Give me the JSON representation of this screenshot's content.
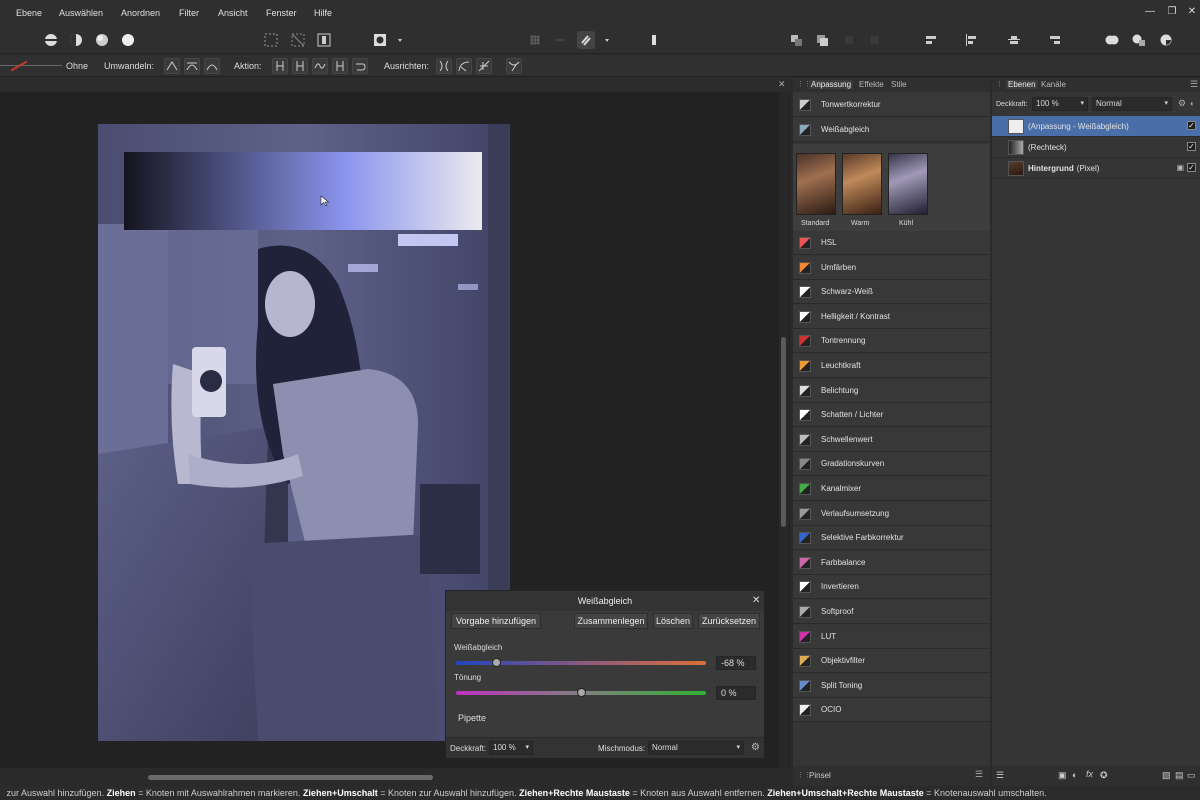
{
  "menu": [
    "Ebene",
    "Auswählen",
    "Anordnen",
    "Filter",
    "Ansicht",
    "Fenster",
    "Hilfe"
  ],
  "context_bar": {
    "stroke_value": "Ohne",
    "convert_label": "Umwandeln:",
    "action_label": "Aktion:",
    "align_label": "Ausrichten:"
  },
  "canvas": {
    "text_box_gradient": [
      "#14141e",
      "#8b95ee",
      "#eceaee"
    ]
  },
  "dialog": {
    "title": "Weißabgleich",
    "buttons": [
      "Vorgabe hinzufügen",
      "Zusammenlegen",
      "Löschen",
      "Zurücksetzen"
    ],
    "white_balance_label": "Weißabgleich",
    "white_balance_value": "-68 %",
    "white_balance_level": -0.68,
    "tint_label": "Tönung",
    "tint_value": "0 %",
    "tint_level": 0,
    "pipette_label": "Pipette",
    "opacity_label": "Deckkraft:",
    "opacity_value": "100 %",
    "blend_label": "Mischmodus:",
    "blend_value": "Normal"
  },
  "adjustments_panel": {
    "tabs": [
      "Anpassung",
      "Effekte",
      "Stile"
    ],
    "items_top": [
      {
        "label": "Tonwertkorrektur",
        "icon": "levels-icon"
      },
      {
        "label": "Weißabgleich",
        "icon": "white-balance-icon"
      }
    ],
    "presets": [
      "Standard",
      "Warm",
      "Kühl"
    ],
    "items": [
      {
        "label": "HSL",
        "icon": "hsl-icon"
      },
      {
        "label": "Umfärben",
        "icon": "recolor-icon"
      },
      {
        "label": "Schwarz-Weiß",
        "icon": "black-white-icon"
      },
      {
        "label": "Helligkeit / Kontrast",
        "icon": "brightness-contrast-icon"
      },
      {
        "label": "Tontrennung",
        "icon": "posterize-icon"
      },
      {
        "label": "Leuchtkraft",
        "icon": "vibrance-icon"
      },
      {
        "label": "Belichtung",
        "icon": "exposure-icon"
      },
      {
        "label": "Schatten / Lichter",
        "icon": "shadows-highlights-icon"
      },
      {
        "label": "Schwellenwert",
        "icon": "threshold-icon"
      },
      {
        "label": "Gradationskurven",
        "icon": "curves-icon"
      },
      {
        "label": "Kanalmixer",
        "icon": "channel-mixer-icon"
      },
      {
        "label": "Verlaufsumsetzung",
        "icon": "gradient-map-icon"
      },
      {
        "label": "Selektive Farbkorrektur",
        "icon": "selective-color-icon"
      },
      {
        "label": "Farbbalance",
        "icon": "color-balance-icon"
      },
      {
        "label": "Invertieren",
        "icon": "invert-icon"
      },
      {
        "label": "Softproof",
        "icon": "soft-proof-icon"
      },
      {
        "label": "LUT",
        "icon": "lut-icon"
      },
      {
        "label": "Objektivfilter",
        "icon": "lens-filter-icon"
      },
      {
        "label": "Split Toning",
        "icon": "split-toning-icon"
      },
      {
        "label": "OCIO",
        "icon": "ocio-icon"
      }
    ],
    "bottom_tab": "Pinsel"
  },
  "layers_panel": {
    "tabs": [
      "Ebenen",
      "Kanäle"
    ],
    "opacity_label": "Deckkraft:",
    "opacity_value": "100 %",
    "blend_value": "Normal",
    "layers": [
      {
        "name": "(Anpassung - Weißabgleich)",
        "selected": true
      },
      {
        "name": "(Rechteck)",
        "selected": false
      },
      {
        "name": "Hintergrund",
        "suffix": "(Pixel)",
        "selected": false
      }
    ]
  },
  "statusbar": {
    "segments": [
      {
        "t": " zur Auswahl hinzufügen. ",
        "b": false
      },
      {
        "t": "Ziehen",
        "b": true
      },
      {
        "t": " = Knoten mit Auswahlrahmen markieren. ",
        "b": false
      },
      {
        "t": "Ziehen+Umschalt",
        "b": true
      },
      {
        "t": " = Knoten zur Auswahl hinzufügen. ",
        "b": false
      },
      {
        "t": "Ziehen+Rechte Maustaste",
        "b": true
      },
      {
        "t": " = Knoten aus Auswahl entfernen. ",
        "b": false
      },
      {
        "t": "Ziehen+Umschalt+Rechte Maustaste",
        "b": true
      },
      {
        "t": " = Knotenauswahl umschalten.",
        "b": false
      }
    ]
  }
}
